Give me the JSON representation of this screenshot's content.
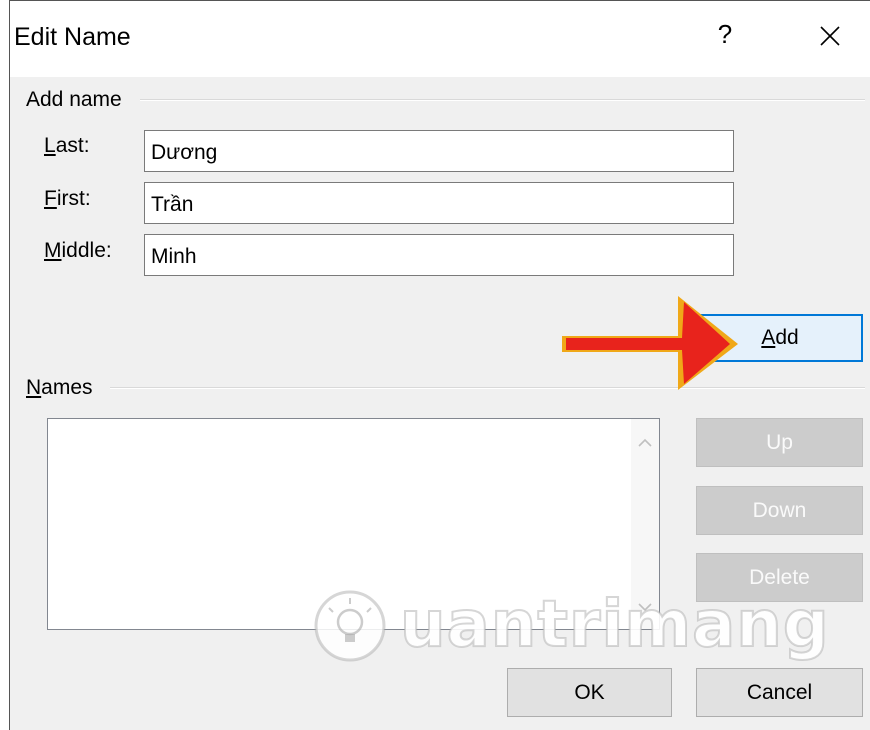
{
  "dialog": {
    "title": "Edit Name",
    "help_label": "?",
    "close_icon": "close-icon"
  },
  "add_name": {
    "group_label": "Add name",
    "fields": {
      "last": {
        "label_hotkey": "L",
        "label_rest": "ast:",
        "value": "Dương"
      },
      "first": {
        "label_hotkey": "F",
        "label_rest": "irst:",
        "value": "Trần"
      },
      "middle": {
        "label_hotkey": "M",
        "label_rest": "iddle:",
        "value": "Minh"
      }
    },
    "add_button": {
      "hotkey": "A",
      "rest": "dd"
    }
  },
  "names": {
    "group_label_hotkey": "N",
    "group_label_rest": "ames",
    "items": [],
    "buttons": {
      "up": "Up",
      "down": "Down",
      "delete": "Delete"
    }
  },
  "footer": {
    "ok": "OK",
    "cancel": "Cancel"
  },
  "watermark": {
    "text": "uantrimang",
    "icon": "lightbulb-icon"
  },
  "annotation": {
    "icon": "red-arrow-icon",
    "color": "#e8231c"
  },
  "colors": {
    "dialog_bg": "#f0f0f0",
    "default_button_border": "#0078d7",
    "disabled_button_bg": "#cccccc"
  }
}
